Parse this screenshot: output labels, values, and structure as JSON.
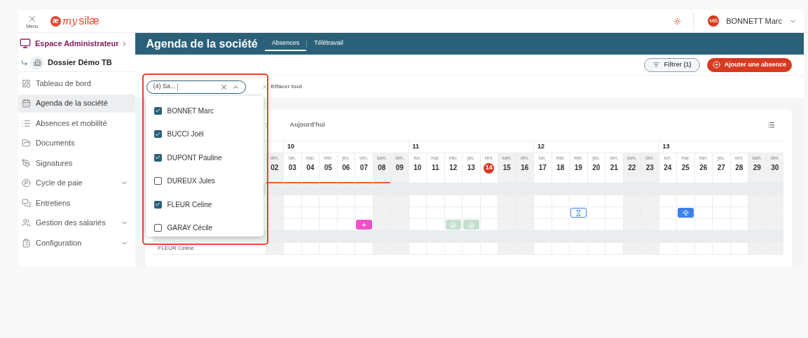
{
  "topbar": {
    "menu_label": "Menu",
    "logo": {
      "mark": "æ",
      "word1": "my",
      "word2": "silæ"
    },
    "user": {
      "initials": "MB",
      "name": "BONNETT Marc"
    }
  },
  "sidebar": {
    "space": "Espace Administrateur",
    "dossier": "Dossier Démo TB",
    "items": [
      {
        "label": "Tableau de bord",
        "selected": false,
        "has_submenu": false
      },
      {
        "label": "Agenda de la société",
        "selected": true,
        "has_submenu": false
      },
      {
        "label": "Absences et mobilité",
        "selected": false,
        "has_submenu": false
      },
      {
        "label": "Documents",
        "selected": false,
        "has_submenu": false
      },
      {
        "label": "Signatures",
        "selected": false,
        "has_submenu": false
      },
      {
        "label": "Cycle de paie",
        "selected": false,
        "has_submenu": true
      },
      {
        "label": "Entretiens",
        "selected": false,
        "has_submenu": false
      },
      {
        "label": "Gestion des salariés",
        "selected": false,
        "has_submenu": true
      },
      {
        "label": "Configuration",
        "selected": false,
        "has_submenu": true
      }
    ]
  },
  "header": {
    "title": "Agenda de la société",
    "tabs": [
      {
        "label": "Absences",
        "selected": true
      },
      {
        "label": "Télétravail",
        "selected": false
      }
    ]
  },
  "toolbar": {
    "filter_button": "Filtrer (1)",
    "add_button": "Ajouter une absence"
  },
  "filter": {
    "value": "(4) Sa...",
    "clear_all": "Effacer tout",
    "options": [
      {
        "label": "BONNET Marc",
        "checked": true
      },
      {
        "label": "BUCCI Joël",
        "checked": true
      },
      {
        "label": "DUPONT Pauline",
        "checked": true
      },
      {
        "label": "DUREUX Jules",
        "checked": false
      },
      {
        "label": "FLEUR Celine",
        "checked": true
      },
      {
        "label": "GARAY Cécile",
        "checked": false
      }
    ]
  },
  "calendar": {
    "today_button": "Aujourd'hui",
    "weeks": [
      {
        "days": [
          {
            "abbr": "dim.",
            "num": "02",
            "weekend": true,
            "today": false,
            "underlined": true
          }
        ]
      },
      {
        "label": "10",
        "days": [
          {
            "abbr": "lun.",
            "num": "03",
            "weekend": false,
            "today": false,
            "underlined": true
          },
          {
            "abbr": "mar.",
            "num": "04",
            "weekend": false,
            "today": false,
            "underlined": true
          },
          {
            "abbr": "mer.",
            "num": "05",
            "weekend": false,
            "today": false,
            "underlined": true
          },
          {
            "abbr": "jeu.",
            "num": "06",
            "weekend": false,
            "today": false,
            "underlined": true
          },
          {
            "abbr": "ven.",
            "num": "07",
            "weekend": false,
            "today": false,
            "underlined": true
          },
          {
            "abbr": "sam.",
            "num": "08",
            "weekend": true,
            "today": false,
            "underlined": true
          },
          {
            "abbr": "dim.",
            "num": "09",
            "weekend": true,
            "today": false,
            "underlined": false
          }
        ]
      },
      {
        "label": "11",
        "days": [
          {
            "abbr": "lun.",
            "num": "10",
            "weekend": false,
            "today": false,
            "underlined": false
          },
          {
            "abbr": "mar.",
            "num": "11",
            "weekend": false,
            "today": false,
            "underlined": false
          },
          {
            "abbr": "mer.",
            "num": "12",
            "weekend": false,
            "today": false,
            "underlined": false
          },
          {
            "abbr": "jeu.",
            "num": "13",
            "weekend": false,
            "today": false,
            "underlined": false
          },
          {
            "abbr": "ven.",
            "num": "14",
            "weekend": false,
            "today": true,
            "underlined": false
          },
          {
            "abbr": "sam.",
            "num": "15",
            "weekend": true,
            "today": false,
            "underlined": false
          },
          {
            "abbr": "dim.",
            "num": "16",
            "weekend": true,
            "today": false,
            "underlined": false
          }
        ]
      },
      {
        "label": "12",
        "days": [
          {
            "abbr": "lun.",
            "num": "17",
            "weekend": false,
            "today": false,
            "underlined": false
          },
          {
            "abbr": "mar.",
            "num": "18",
            "weekend": false,
            "today": false,
            "underlined": false
          },
          {
            "abbr": "mer.",
            "num": "19",
            "weekend": false,
            "today": false,
            "underlined": false
          },
          {
            "abbr": "jeu.",
            "num": "20",
            "weekend": false,
            "today": false,
            "underlined": false
          },
          {
            "abbr": "ven.",
            "num": "21",
            "weekend": false,
            "today": false,
            "underlined": false
          },
          {
            "abbr": "sam.",
            "num": "22",
            "weekend": true,
            "today": false,
            "underlined": false
          },
          {
            "abbr": "dim.",
            "num": "23",
            "weekend": true,
            "today": false,
            "underlined": false
          }
        ]
      },
      {
        "label": "13",
        "days": [
          {
            "abbr": "lun.",
            "num": "24",
            "weekend": false,
            "today": false,
            "underlined": false
          },
          {
            "abbr": "mar.",
            "num": "25",
            "weekend": false,
            "today": false,
            "underlined": false
          },
          {
            "abbr": "mer.",
            "num": "26",
            "weekend": false,
            "today": false,
            "underlined": false
          },
          {
            "abbr": "jeu.",
            "num": "27",
            "weekend": false,
            "today": false,
            "underlined": false
          },
          {
            "abbr": "ven.",
            "num": "28",
            "weekend": false,
            "today": false,
            "underlined": false
          },
          {
            "abbr": "sam.",
            "num": "29",
            "weekend": true,
            "today": false,
            "underlined": false
          },
          {
            "abbr": "dim.",
            "num": "30",
            "weekend": true,
            "today": false,
            "underlined": false
          }
        ]
      }
    ],
    "rows": [
      {
        "kind": "group"
      },
      {
        "kind": "person"
      },
      {
        "kind": "person",
        "cells": [
          {
            "kind": "empty"
          },
          {
            "kind": "empty"
          },
          {
            "kind": "empty"
          },
          {
            "kind": "empty"
          },
          {
            "kind": "empty"
          },
          {
            "kind": "empty"
          },
          {
            "kind": "empty"
          },
          {
            "kind": "empty"
          },
          {
            "kind": "empty"
          },
          {
            "kind": "empty"
          },
          {
            "kind": "empty"
          },
          {
            "kind": "empty"
          },
          {
            "kind": "empty"
          },
          {
            "kind": "empty"
          },
          {
            "kind": "empty"
          },
          {
            "kind": "empty"
          },
          {
            "kind": "empty"
          },
          {
            "kind": "pending",
            "color": "#3b82e6"
          },
          {
            "kind": "empty"
          },
          {
            "kind": "empty"
          },
          {
            "kind": "empty"
          },
          {
            "kind": "empty"
          },
          {
            "kind": "empty"
          },
          {
            "kind": "vacation",
            "color": "#3b82e6"
          },
          {
            "kind": "empty"
          },
          {
            "kind": "empty"
          },
          {
            "kind": "empty"
          },
          {
            "kind": "empty"
          },
          {
            "kind": "empty"
          }
        ]
      },
      {
        "kind": "person",
        "cells": [
          {
            "kind": "empty"
          },
          {
            "kind": "empty"
          },
          {
            "kind": "empty"
          },
          {
            "kind": "empty"
          },
          {
            "kind": "empty"
          },
          {
            "kind": "sickness",
            "color": "#f050c8"
          },
          {
            "kind": "empty"
          },
          {
            "kind": "empty"
          },
          {
            "kind": "empty"
          },
          {
            "kind": "empty"
          },
          {
            "kind": "remote",
            "color": "#c3dfd0"
          },
          {
            "kind": "remote",
            "color": "#c3dfd0"
          },
          {
            "kind": "empty"
          },
          {
            "kind": "empty"
          },
          {
            "kind": "empty"
          },
          {
            "kind": "empty"
          },
          {
            "kind": "empty"
          },
          {
            "kind": "empty"
          },
          {
            "kind": "empty"
          },
          {
            "kind": "empty"
          },
          {
            "kind": "empty"
          },
          {
            "kind": "empty"
          },
          {
            "kind": "empty"
          },
          {
            "kind": "empty"
          },
          {
            "kind": "empty"
          },
          {
            "kind": "empty"
          },
          {
            "kind": "empty"
          },
          {
            "kind": "empty"
          },
          {
            "kind": "empty"
          }
        ]
      },
      {
        "kind": "group"
      },
      {
        "kind": "person",
        "name": "FLEUR Celine"
      }
    ]
  }
}
